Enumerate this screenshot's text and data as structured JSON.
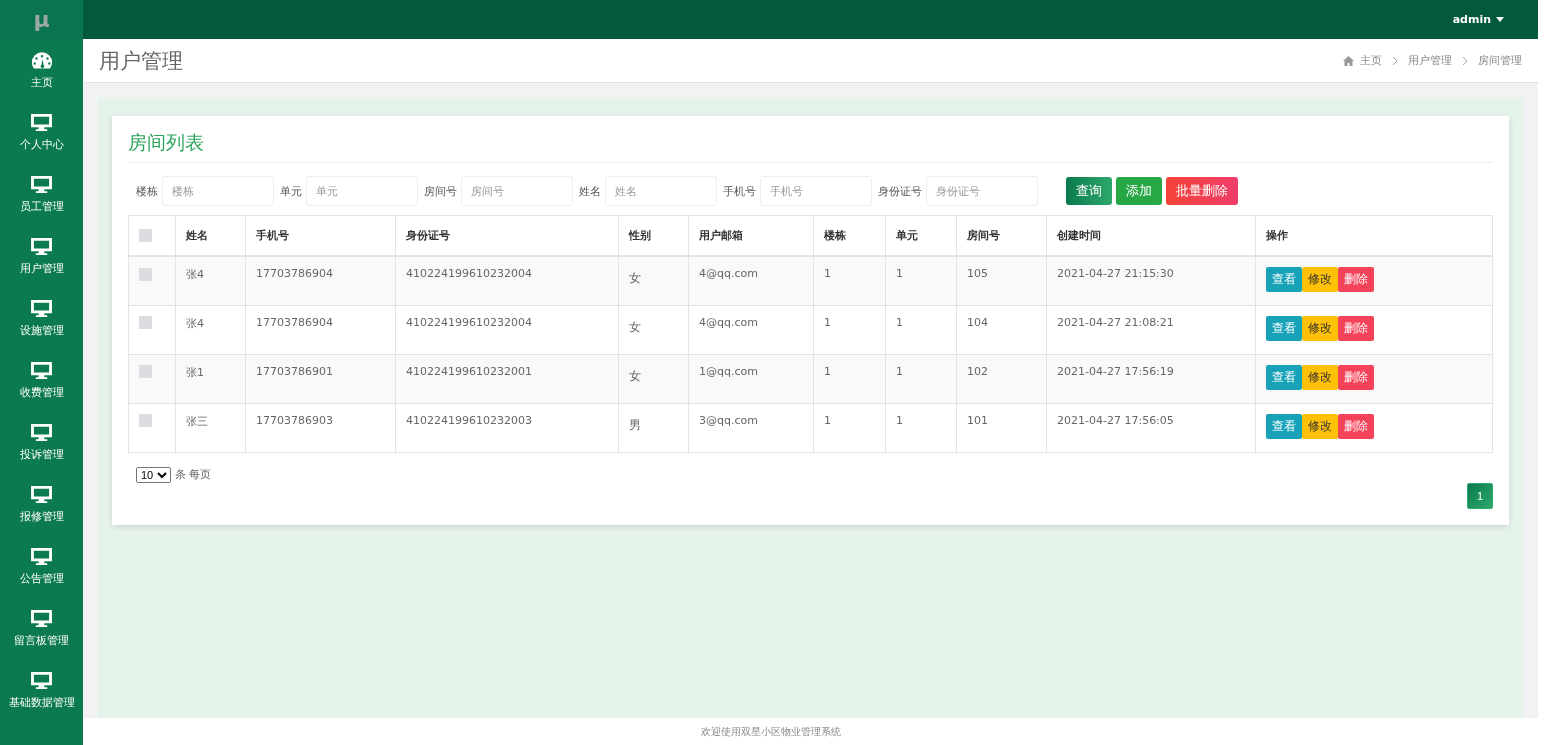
{
  "logo": "μ",
  "user_menu": {
    "label": "admin"
  },
  "sidebar": {
    "items": [
      {
        "label": "主页",
        "kind": "dashboard",
        "selected": false
      },
      {
        "label": "个人中心",
        "kind": "monitor",
        "selected": false
      },
      {
        "label": "员工管理",
        "kind": "monitor",
        "selected": false
      },
      {
        "label": "用户管理",
        "kind": "monitor",
        "selected": false
      },
      {
        "label": "设施管理",
        "kind": "monitor",
        "selected": false
      },
      {
        "label": "收费管理",
        "kind": "monitor",
        "selected": false
      },
      {
        "label": "投诉管理",
        "kind": "monitor",
        "selected": false
      },
      {
        "label": "报修管理",
        "kind": "monitor",
        "selected": false
      },
      {
        "label": "公告管理",
        "kind": "monitor",
        "selected": false
      },
      {
        "label": "留言板管理",
        "kind": "monitor",
        "selected": false
      },
      {
        "label": "基础数据管理",
        "kind": "monitor",
        "selected": false
      }
    ]
  },
  "page_title": "用户管理",
  "breadcrumb": [
    "主页",
    "用户管理",
    "房间管理"
  ],
  "card_title": "房间列表",
  "filters": [
    {
      "label": "楼栋",
      "placeholder": "楼栋"
    },
    {
      "label": "单元",
      "placeholder": "单元"
    },
    {
      "label": "房间号",
      "placeholder": "房间号"
    },
    {
      "label": "姓名",
      "placeholder": "姓名"
    },
    {
      "label": "手机号",
      "placeholder": "手机号"
    },
    {
      "label": "身份证号",
      "placeholder": "身份证号"
    }
  ],
  "actions": [
    {
      "label": "查询",
      "kind": "search"
    },
    {
      "label": "添加",
      "kind": "add"
    },
    {
      "label": "批量删除",
      "kind": "delete"
    }
  ],
  "table": {
    "select_all_checked": false,
    "columns": [
      "姓名",
      "手机号",
      "身份证号",
      "性别",
      "用户邮箱",
      "楼栋",
      "单元",
      "房间号",
      "创建时间",
      "操作"
    ],
    "rows": [
      {
        "checked": false,
        "cells": [
          "张4",
          "17703786904",
          "410224199610232004",
          "女",
          "4@qq.com",
          "1",
          "1",
          "105",
          "2021-04-27 21:15:30"
        ],
        "buttons": [
          "查看",
          "修改",
          "删除"
        ]
      },
      {
        "checked": false,
        "cells": [
          "张4",
          "17703786904",
          "410224199610232004",
          "女",
          "4@qq.com",
          "1",
          "1",
          "104",
          "2021-04-27 21:08:21"
        ],
        "buttons": [
          "查看",
          "修改",
          "删除"
        ]
      },
      {
        "checked": false,
        "cells": [
          "张1",
          "17703786901",
          "410224199610232001",
          "女",
          "1@qq.com",
          "1",
          "1",
          "102",
          "2021-04-27 17:56:19"
        ],
        "buttons": [
          "查看",
          "修改",
          "删除"
        ]
      },
      {
        "checked": false,
        "cells": [
          "张三",
          "17703786903",
          "410224199610232003",
          "男",
          "3@qq.com",
          "1",
          "1",
          "101",
          "2021-04-27 17:56:05"
        ],
        "buttons": [
          "查看",
          "修改",
          "删除"
        ]
      }
    ]
  },
  "page_size": {
    "value": "10",
    "label": "条 每页"
  },
  "pagination": [
    {
      "label": "1",
      "selected": true
    }
  ],
  "footer": "欢迎使用双星小区物业管理系统"
}
